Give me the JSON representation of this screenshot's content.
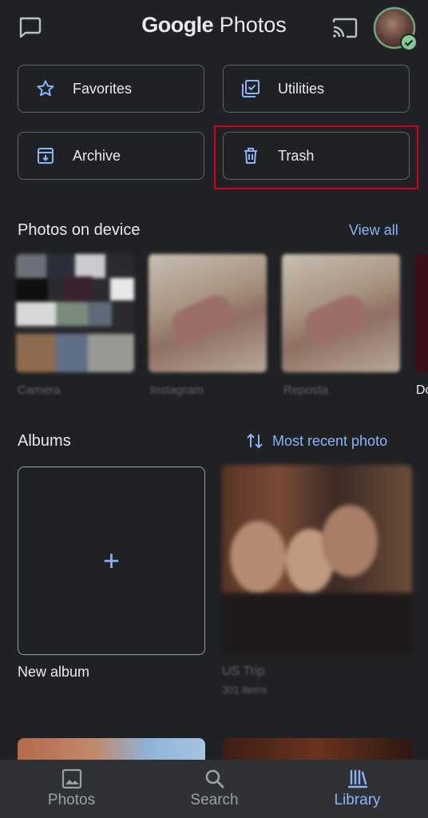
{
  "header": {
    "brand_google": "Google",
    "brand_photos": "Photos"
  },
  "tiles": [
    {
      "label": "Favorites",
      "icon": "star-icon"
    },
    {
      "label": "Utilities",
      "icon": "utilities-icon"
    },
    {
      "label": "Archive",
      "icon": "archive-icon"
    },
    {
      "label": "Trash",
      "icon": "trash-icon"
    }
  ],
  "device_section": {
    "title": "Photos on device",
    "view_all": "View all",
    "folders": [
      "Camera",
      "Instagram",
      "Reposta",
      "Do"
    ]
  },
  "albums_section": {
    "title": "Albums",
    "sort_label": "Most recent photo",
    "new_album": "New album",
    "albums": [
      {
        "name": "US Trip",
        "count": "301 items"
      }
    ]
  },
  "bottom_nav": [
    {
      "label": "Photos",
      "icon": "photo-icon",
      "active": false
    },
    {
      "label": "Search",
      "icon": "search-icon",
      "active": false
    },
    {
      "label": "Library",
      "icon": "library-icon",
      "active": true
    }
  ],
  "colors": {
    "background": "#202124",
    "accent": "#8ab4f8",
    "highlight": "#d0021b",
    "nav_background": "#303134"
  }
}
